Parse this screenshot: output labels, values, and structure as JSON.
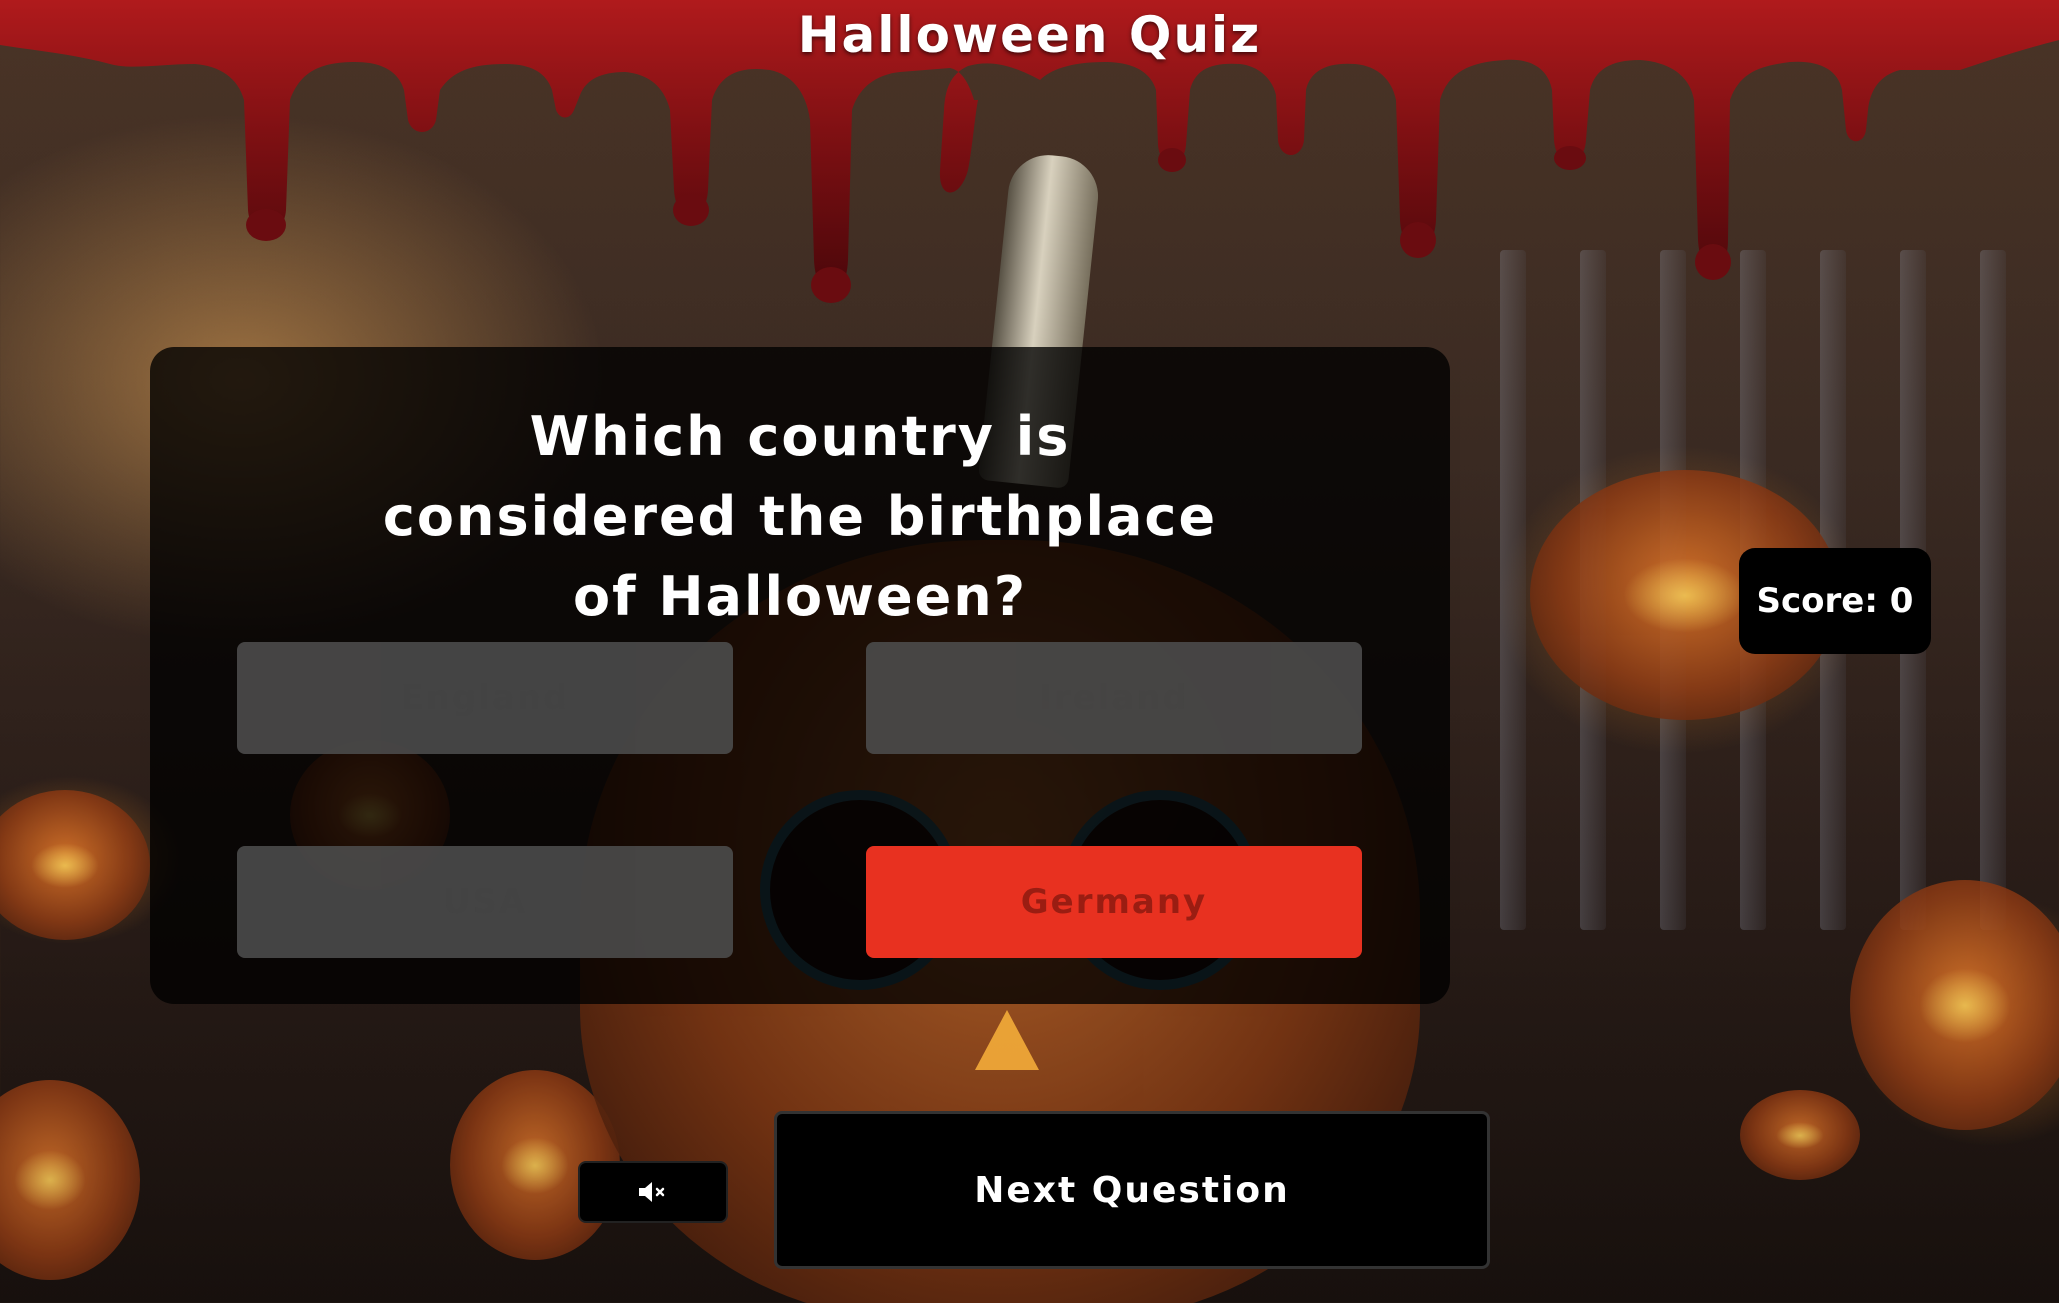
{
  "header": {
    "title": "Halloween Quiz"
  },
  "quiz": {
    "question": "Which country is considered the birthplace of Halloween?",
    "answers": [
      {
        "label": "England",
        "state": "disabled"
      },
      {
        "label": "Ireland",
        "state": "disabled"
      },
      {
        "label": "USA",
        "state": "disabled"
      },
      {
        "label": "Germany",
        "state": "wrong"
      }
    ]
  },
  "score": {
    "label": "Score: 0"
  },
  "controls": {
    "mute_icon": "speaker-muted-icon",
    "next_label": "Next Question"
  },
  "colors": {
    "blood": "#7a0f12",
    "wrong_answer": "#e83120",
    "disabled_answer": "#4b4b4b",
    "panel": "#000000"
  }
}
